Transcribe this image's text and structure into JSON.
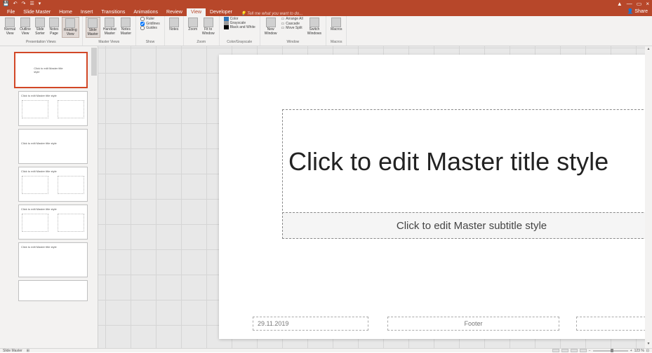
{
  "titlebar": {
    "save_icon": "💾",
    "undo_icon": "↶",
    "redo_icon": "↷",
    "touch_icon": "☰",
    "dropdown_icon": "▾",
    "min_icon": "—",
    "restore_icon": "▭",
    "close_icon": "×",
    "ribbon_toggle": "▲"
  },
  "tabs": {
    "file": "File",
    "slide_master": "Slide Master",
    "home": "Home",
    "insert": "Insert",
    "transitions": "Transitions",
    "animations": "Animations",
    "review": "Review",
    "view": "View",
    "developer": "Developer",
    "tellme": "Tell me what you want to do...",
    "share": "Share"
  },
  "ribbon": {
    "views": {
      "normal": "Normal\nView",
      "outline": "Outline\nView",
      "slide_sorter": "Slide\nSorter",
      "notes_page": "Notes\nPage",
      "reading": "Reading\nView",
      "label": "Presentation Views"
    },
    "masters": {
      "slide_master": "Slide\nMaster",
      "handout_master": "Handout\nMaster",
      "notes_master": "Notes\nMaster",
      "label": "Master Views"
    },
    "show": {
      "ruler": "Ruler",
      "gridlines": "Gridlines",
      "guides": "Guides",
      "label": "Show"
    },
    "notes": {
      "btn": "Notes"
    },
    "zoom": {
      "zoom": "Zoom",
      "fit": "Fit to\nWindow",
      "label": "Zoom"
    },
    "color": {
      "color": "Color",
      "gray": "Grayscale",
      "bw": "Black and White",
      "label": "Color/Grayscale"
    },
    "window": {
      "new": "New\nWindow",
      "arrange": "Arrange All",
      "cascade": "Cascade",
      "split": "Move Split",
      "switch": "Switch\nWindows",
      "label": "Window"
    },
    "macros": {
      "btn": "Macros",
      "label": "Macros"
    }
  },
  "thumbs": {
    "master": "Click to edit Master title style",
    "layout1": "Click to edit Master title style",
    "layout2": "Click to edit Master title style",
    "layout3": "Click to edit Master title style",
    "layout4": "Click to edit Master title style",
    "layout5": "Click to edit Master title style"
  },
  "slide": {
    "title": "Click to edit Master title style",
    "subtitle": "Click to edit Master subtitle style",
    "date": "29.11.2019",
    "footer": "Footer",
    "number": "‹#›"
  },
  "status": {
    "left": "Slide Master",
    "notes": "⊞",
    "zoom": "123 %",
    "fit": "⊡"
  }
}
